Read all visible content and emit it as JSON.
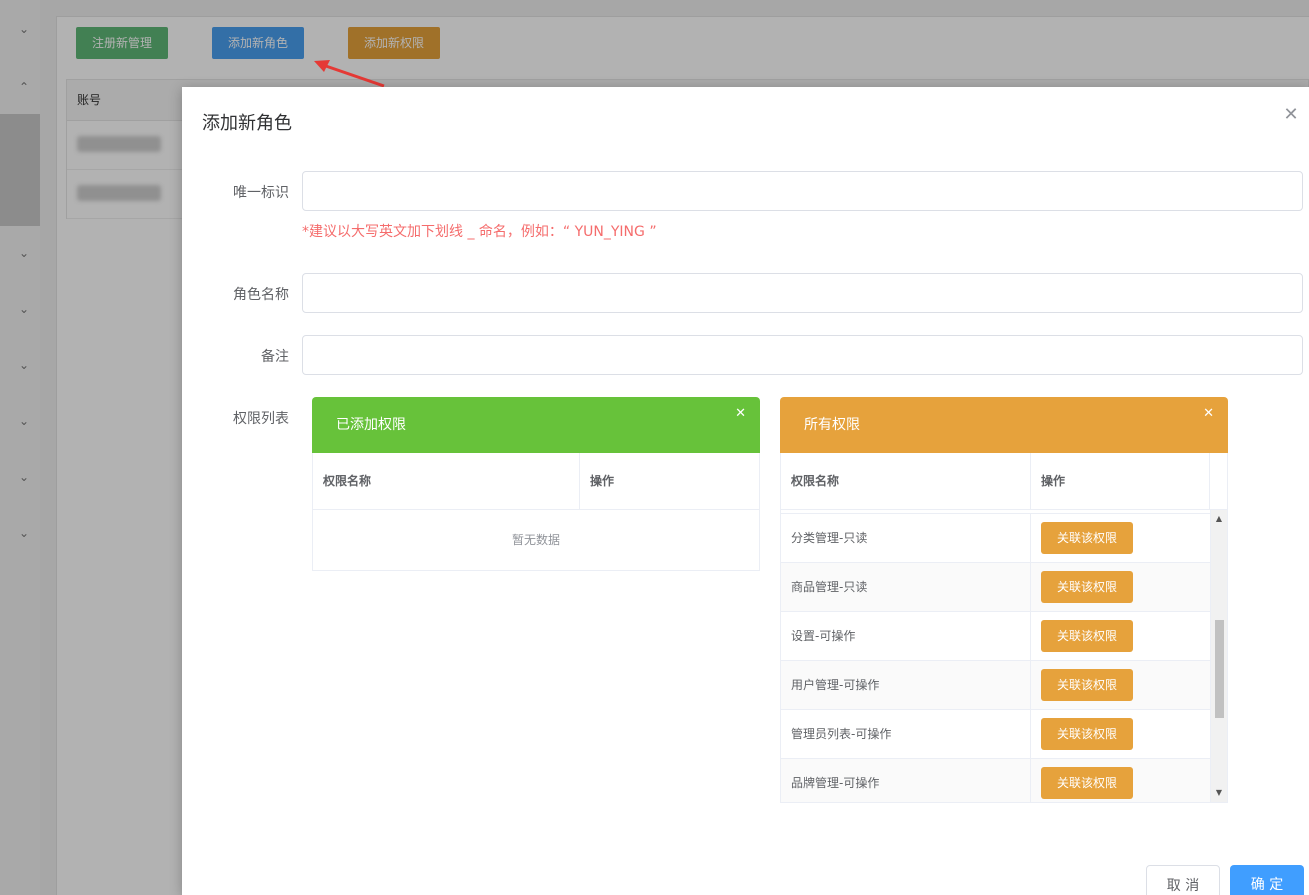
{
  "background": {
    "buttons": {
      "register_admin": "注册新管理",
      "add_role": "添加新角色",
      "add_permission": "添加新权限"
    },
    "table_header": "账号"
  },
  "dialog": {
    "title": "添加新角色",
    "fields": {
      "identifier_label": "唯一标识",
      "identifier_value": "",
      "identifier_hint": "*建议以大写英文加下划线 _ 命名，例如：“ YUN_YING ”",
      "role_name_label": "角色名称",
      "role_name_value": "",
      "remark_label": "备注",
      "remark_value": "",
      "permission_list_label": "权限列表"
    },
    "added_panel": {
      "title": "已添加权限",
      "col_name": "权限名称",
      "col_action": "操作",
      "empty_text": "暂无数据"
    },
    "all_panel": {
      "title": "所有权限",
      "col_name": "权限名称",
      "col_action": "操作",
      "rows": [
        {
          "name": "分类管理-只读",
          "action": "关联该权限"
        },
        {
          "name": "商品管理-只读",
          "action": "关联该权限"
        },
        {
          "name": "设置-可操作",
          "action": "关联该权限"
        },
        {
          "name": "用户管理-可操作",
          "action": "关联该权限"
        },
        {
          "name": "管理员列表-可操作",
          "action": "关联该权限"
        },
        {
          "name": "品牌管理-可操作",
          "action": "关联该权限"
        }
      ]
    },
    "footer": {
      "cancel": "取 消",
      "confirm": "确 定"
    }
  },
  "colors": {
    "added_header": "#67c23a",
    "all_header": "#e6a23c",
    "hint": "#f56c6c",
    "primary": "#409eff"
  }
}
